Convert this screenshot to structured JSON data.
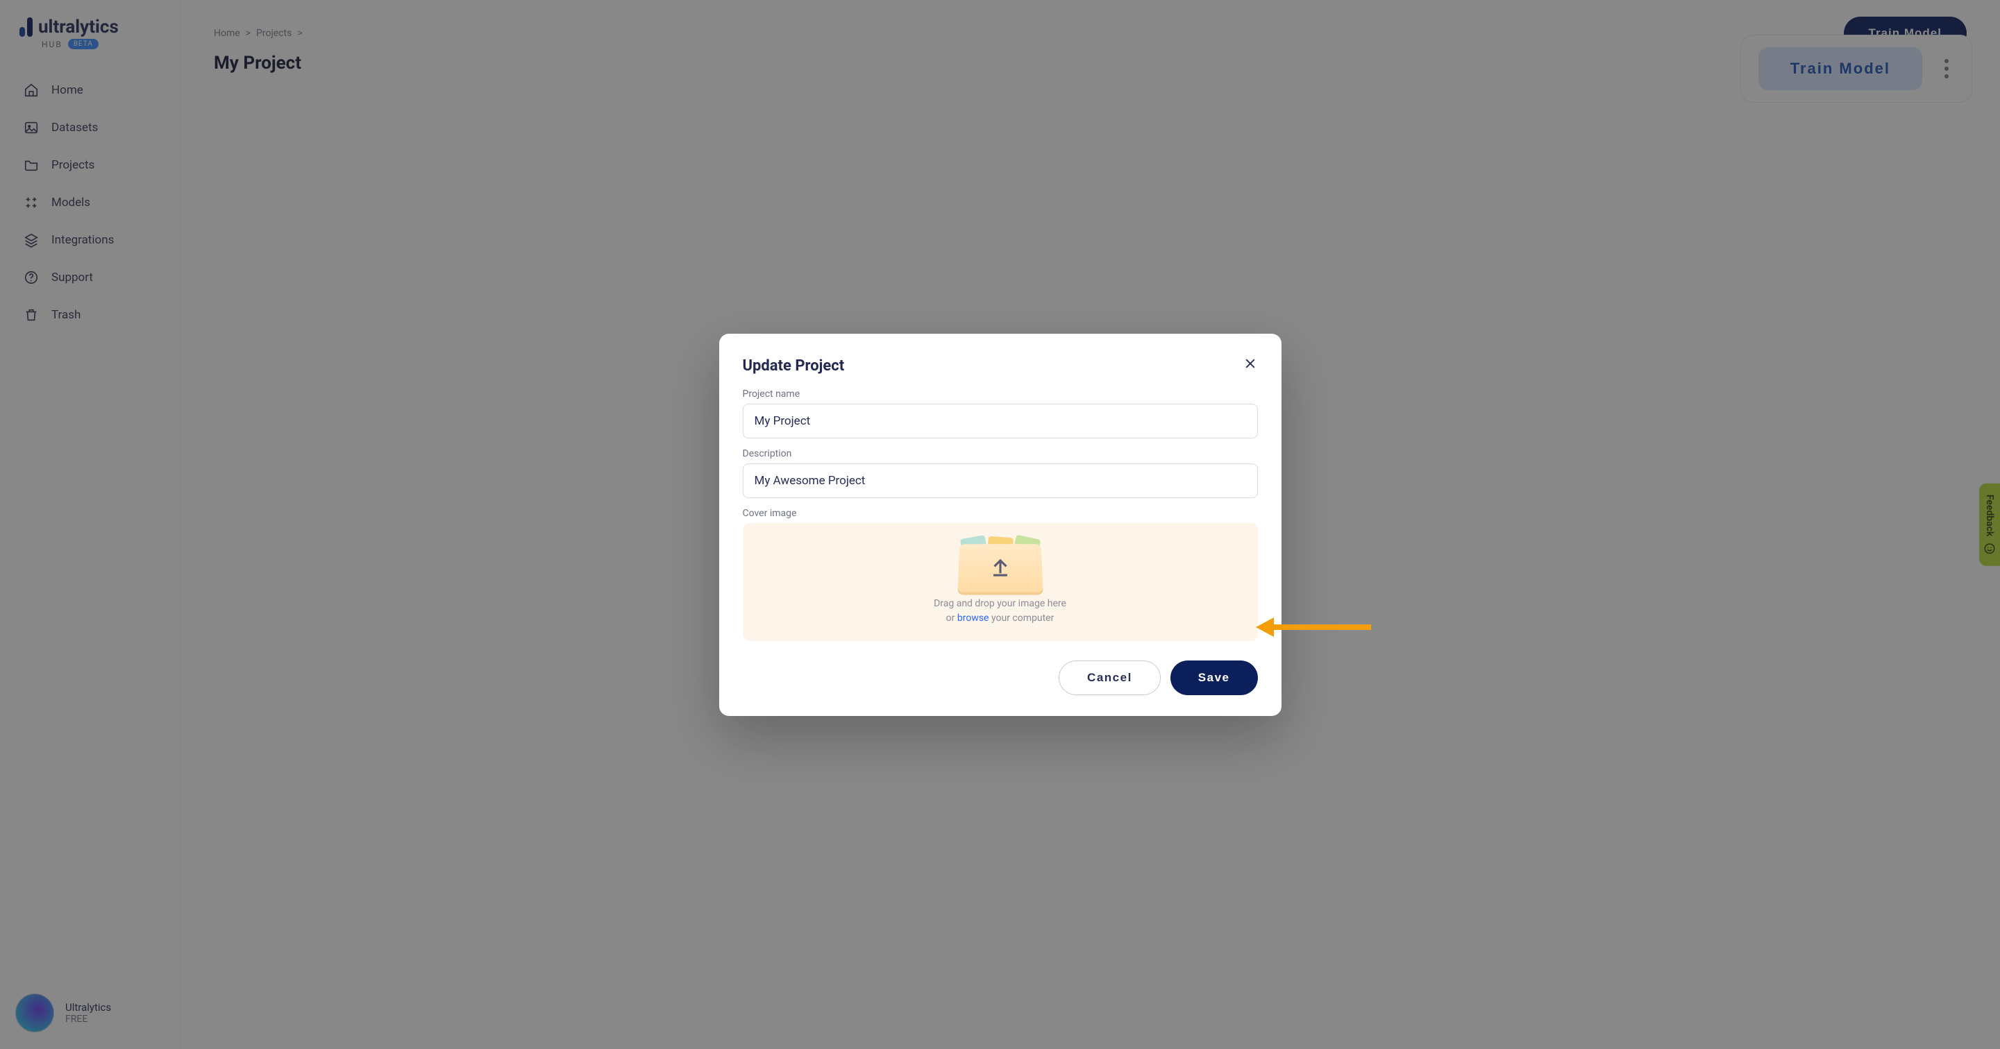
{
  "brand": {
    "name": "ultralytics",
    "sub": "HUB",
    "badge": "BETA"
  },
  "sidebar": {
    "items": [
      {
        "label": "Home",
        "icon": "home-icon"
      },
      {
        "label": "Datasets",
        "icon": "image-icon"
      },
      {
        "label": "Projects",
        "icon": "folder-icon"
      },
      {
        "label": "Models",
        "icon": "models-icon"
      },
      {
        "label": "Integrations",
        "icon": "layers-icon"
      },
      {
        "label": "Support",
        "icon": "help-icon"
      },
      {
        "label": "Trash",
        "icon": "trash-icon"
      }
    ]
  },
  "user": {
    "name": "Ultralytics",
    "plan": "FREE"
  },
  "breadcrumb": {
    "home": "Home",
    "projects": "Projects"
  },
  "page": {
    "title": "My Project"
  },
  "actions": {
    "train_small": "Train Model",
    "train_large": "Train Model"
  },
  "feedback": {
    "label": "Feedback"
  },
  "modal": {
    "title": "Update Project",
    "labels": {
      "name": "Project name",
      "description": "Description",
      "cover": "Cover image"
    },
    "values": {
      "name": "My Project",
      "description": "My Awesome Project"
    },
    "dropzone": {
      "line1": "Drag and drop your image here",
      "or": "or ",
      "browse": "browse",
      "rest": " your computer"
    },
    "buttons": {
      "cancel": "Cancel",
      "save": "Save"
    }
  }
}
